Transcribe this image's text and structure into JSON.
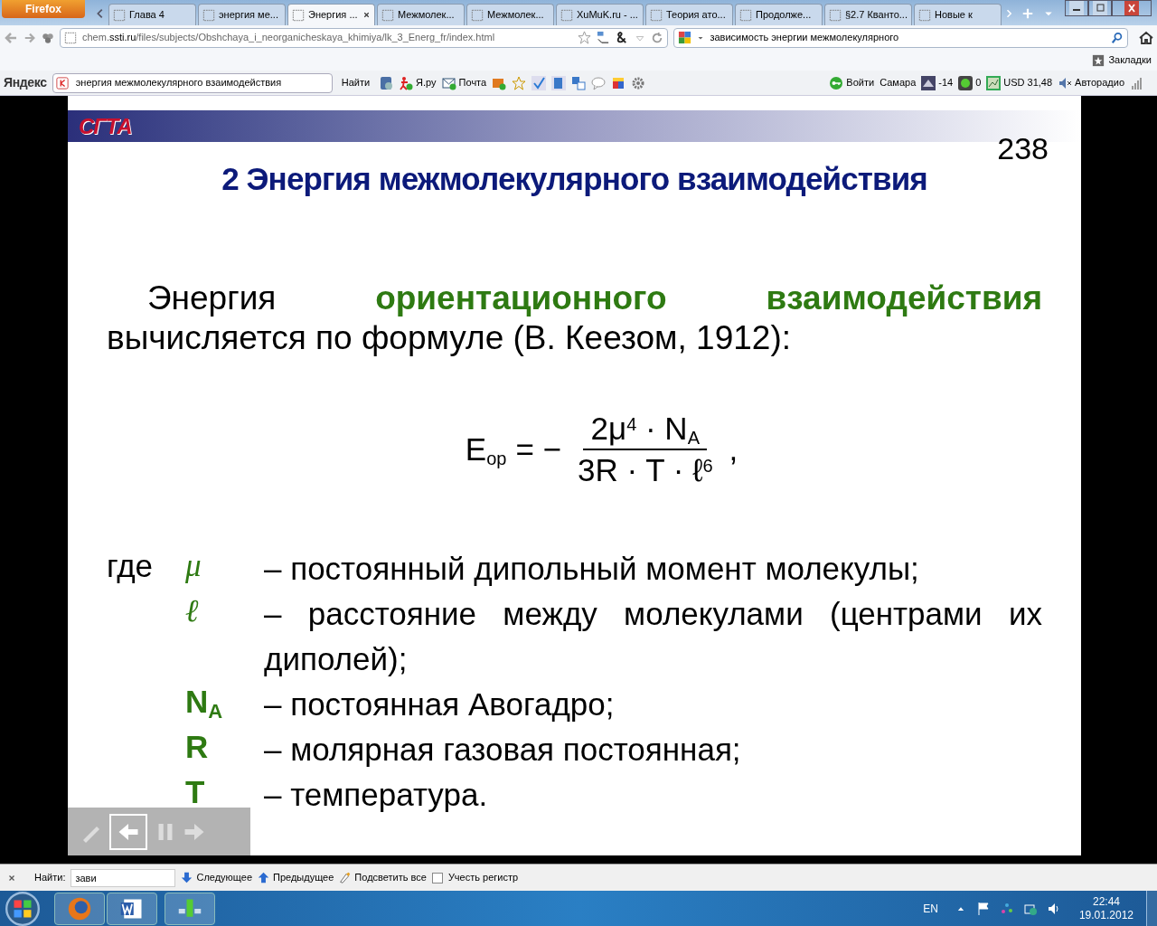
{
  "browser": {
    "menu_button": "Firefox",
    "tabs": [
      {
        "label": "Глава 4",
        "selected": false
      },
      {
        "label": "энергия ме...",
        "selected": false
      },
      {
        "label": "Энергия ...",
        "selected": true
      },
      {
        "label": "Межмолек...",
        "selected": false
      },
      {
        "label": "Межмолек...",
        "selected": false
      },
      {
        "label": "XuMuK.ru - ...",
        "selected": false
      },
      {
        "label": "Теория ато...",
        "selected": false
      },
      {
        "label": "Продолже...",
        "selected": false
      },
      {
        "label": "§2.7 Кванто...",
        "selected": false
      },
      {
        "label": "Новые к",
        "selected": false
      }
    ],
    "address": "chem.**ssti.ru**/files/subjects/Obshchaya_i_neorganicheskaya_khimiya/lk_3_Energ_fr/index.html",
    "search": "зависимость энергии межмолекулярного",
    "bookmarks": "Закладки"
  },
  "yandex_bar": {
    "logo": "Яндекс",
    "query": "энергия межмолекулярного взаимодействия",
    "find": "Найти",
    "yaru": "Я.ру",
    "mail": "Почта",
    "login": "Войти",
    "city": "Самара",
    "temperature": "-14",
    "traffic": "0",
    "currency": "USD 31,48",
    "radio": "Авторадио",
    "radio_muted": true
  },
  "slide": {
    "logo": "СГТА",
    "number": "238",
    "title": "2 Энергия межмолекулярного взаимодействия",
    "paragraph": "Энергия **ориентационного** **взаимодействия** вычисляется по формуле (В. Кеезом, 1912):",
    "formula": {
      "lhs": "E$_{ор}$",
      "operator": "= −",
      "numerator": "2μ$^{4}$ · N$_{A}$",
      "denominator": "3R · T · ℓ$^{6}$",
      "tail": ","
    },
    "where": "где",
    "definitions": [
      {
        "kind": "greek",
        "symbol": "μ",
        "text": "– постоянный дипольный момент молекулы;"
      },
      {
        "kind": "greek",
        "symbol": "ℓ",
        "text": "– расстояние между молекулами (центрами их диполей);"
      },
      {
        "kind": "latin",
        "symbol": "N$_{A}$",
        "text": "– постоянная Авогадро;"
      },
      {
        "kind": "latin",
        "symbol": "R",
        "text": "– молярная газовая постоянная;"
      },
      {
        "kind": "latin",
        "symbol": "T",
        "text": "– температура."
      }
    ]
  },
  "find_bar": {
    "label": "Найти:",
    "value": "зави",
    "next": "Следующее",
    "previous": "Предыдущее",
    "highlight": "Подсветить все",
    "match_case": {
      "label": "Учесть регистр",
      "checked": false
    }
  },
  "taskbar": {
    "language": "EN",
    "time": "22:44",
    "date": "19.01.2012"
  }
}
